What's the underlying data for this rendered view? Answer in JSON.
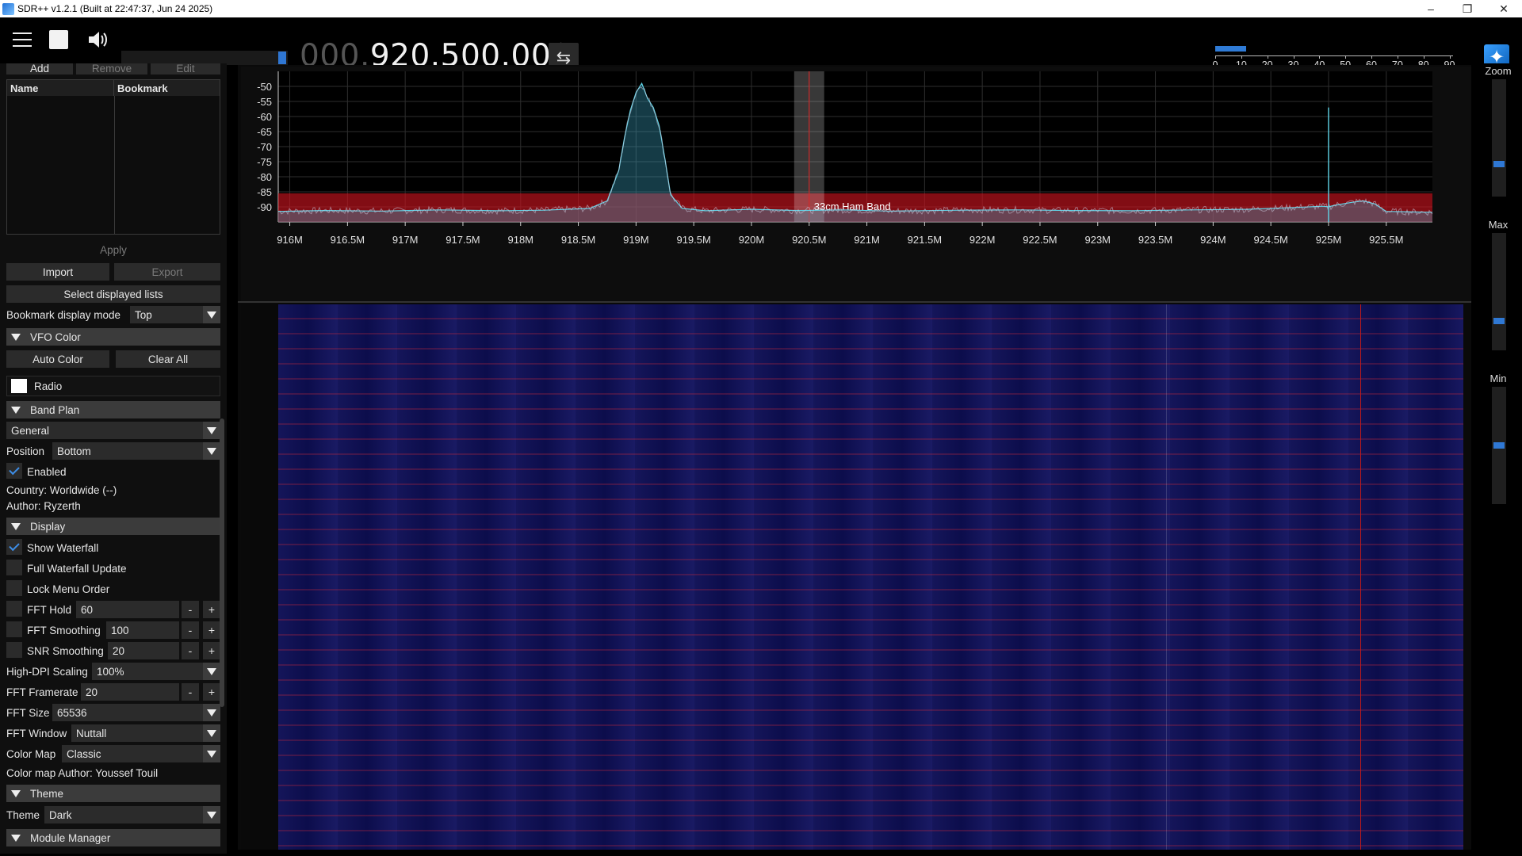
{
  "window": {
    "title": "SDR++ v1.2.1 (Built at 22:47:37, Jun 24 2025)",
    "min_glyph": "–",
    "restore_glyph": "❐",
    "close_glyph": "✕"
  },
  "toolbar": {
    "freq_dim": "000.",
    "freq_bright": "920.500.000",
    "swap_glyph": "⇆",
    "snr_scale": [
      "0",
      "10",
      "20",
      "30",
      "40",
      "50",
      "60",
      "70",
      "80",
      "90"
    ],
    "snr_level": 0.13,
    "volume_level": 0.97
  },
  "sidebar": {
    "bookmark_buttons": {
      "add": "Add",
      "remove": "Remove",
      "edit": "Edit"
    },
    "bookmark_table": {
      "col_name": "Name",
      "col_bookmark": "Bookmark"
    },
    "apply": "Apply",
    "import": "Import",
    "export": "Export",
    "select_lists": "Select displayed lists",
    "bookmark_mode_label": "Bookmark display mode",
    "bookmark_mode_value": "Top",
    "vfo_color": {
      "header": "VFO Color",
      "auto_color": "Auto Color",
      "clear_all": "Clear All",
      "radio": "Radio"
    },
    "band_plan": {
      "header": "Band Plan",
      "plan_value": "General",
      "position_label": "Position",
      "position_value": "Bottom",
      "enabled": "Enabled",
      "country": "Country: Worldwide (--)",
      "author": "Author: Ryzerth"
    },
    "display": {
      "header": "Display",
      "show_waterfall": "Show Waterfall",
      "full_update": "Full Waterfall Update",
      "lock_menu": "Lock Menu Order",
      "fft_hold_label": "FFT Hold",
      "fft_hold_value": "60",
      "fft_smoothing_label": "FFT Smoothing",
      "fft_smoothing_value": "100",
      "snr_smoothing_label": "SNR Smoothing",
      "snr_smoothing_value": "20",
      "hidpi_label": "High-DPI Scaling",
      "hidpi_value": "100%",
      "framerate_label": "FFT Framerate",
      "framerate_value": "20",
      "fft_size_label": "FFT Size",
      "fft_size_value": "65536",
      "fft_window_label": "FFT Window",
      "fft_window_value": "Nuttall",
      "colormap_label": "Color Map",
      "colormap_value": "Classic",
      "colormap_author": "Color map Author: Youssef Touil",
      "minus": "-",
      "plus": "+"
    },
    "theme": {
      "header": "Theme",
      "label": "Theme",
      "value": "Dark"
    },
    "module_manager": {
      "header": "Module Manager"
    }
  },
  "right_panel": {
    "zoom": "Zoom",
    "max": "Max",
    "min": "Min",
    "zoom_level": 0.18,
    "max_level": 0.25,
    "min_level": 0.5
  },
  "chart_data": {
    "type": "line",
    "ylim": [
      -95,
      -45
    ],
    "y_ticks": [
      "-50",
      "-55",
      "-60",
      "-65",
      "-70",
      "-75",
      "-80",
      "-85",
      "-90"
    ],
    "xlim": [
      915.9,
      925.9
    ],
    "x_ticks": [
      "916M",
      "916.5M",
      "917M",
      "917.5M",
      "918M",
      "918.5M",
      "919M",
      "919.5M",
      "920M",
      "920.5M",
      "921M",
      "921.5M",
      "922M",
      "922.5M",
      "923M",
      "923.5M",
      "924M",
      "924.5M",
      "925M",
      "925.5M"
    ],
    "band": {
      "label": "33cm Ham Band",
      "from": 915.9,
      "to": 925.9
    },
    "vfo": {
      "center": 920.5,
      "from": 920.37,
      "to": 920.63
    },
    "series": [
      {
        "x": [
          915.9,
          916.3,
          916.8,
          917.3,
          917.8,
          918.2,
          918.6,
          918.75,
          918.85,
          918.9,
          918.95,
          919.0,
          919.05,
          919.1,
          919.15,
          919.2,
          919.25,
          919.3,
          919.4,
          919.6,
          920.0,
          920.4,
          920.8,
          921.2,
          921.8,
          922.3,
          922.8,
          923.3,
          923.8,
          924.3,
          924.7,
          924.95,
          925.0,
          925.05,
          925.2,
          925.3,
          925.4,
          925.5,
          925.9
        ],
        "values": [
          -91.5,
          -91.2,
          -91.4,
          -91.0,
          -91.3,
          -91.1,
          -90.5,
          -88,
          -78,
          -67,
          -58,
          -52,
          -49,
          -54,
          -57,
          -63,
          -74,
          -86,
          -90.5,
          -91.3,
          -90.8,
          -91.2,
          -91.0,
          -91.4,
          -91.1,
          -91.0,
          -91.2,
          -91.3,
          -91.0,
          -90.8,
          -90.2,
          -89.8,
          -90.0,
          -89.5,
          -88.5,
          -88.0,
          -89.0,
          -91.5,
          -91.8
        ]
      }
    ],
    "spike": {
      "x": 925.0,
      "value": -57
    }
  }
}
